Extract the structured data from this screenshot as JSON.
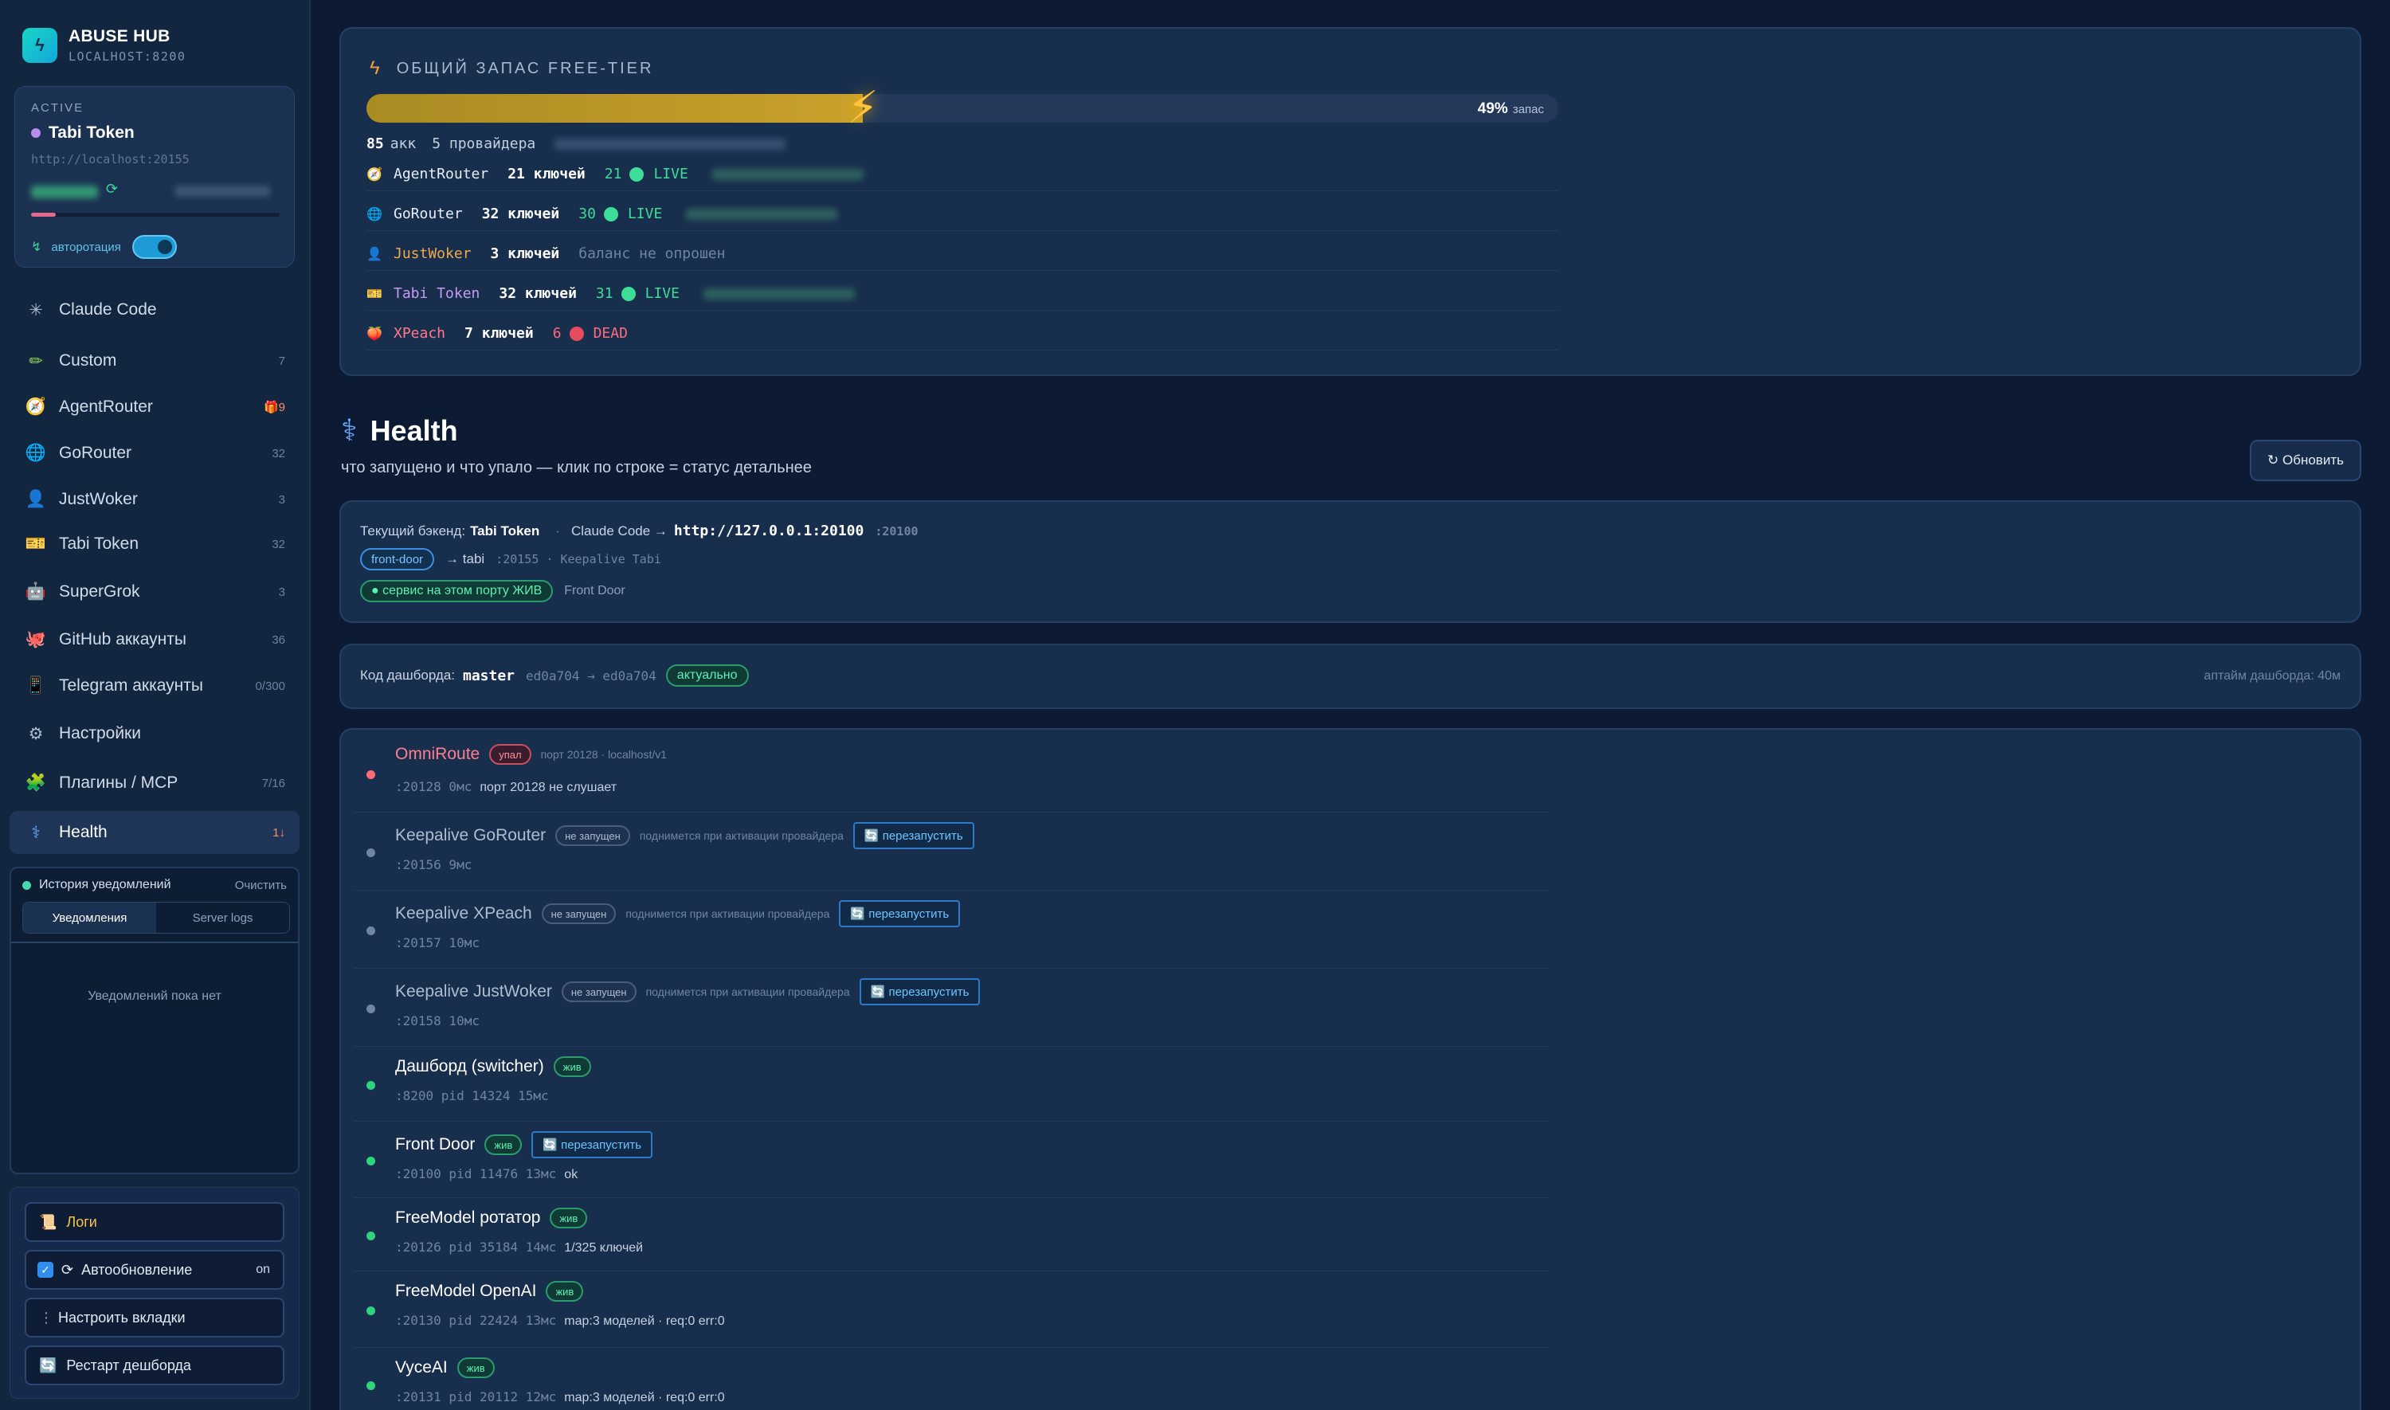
{
  "brand": {
    "title": "ABUSE HUB",
    "subtitle": "LOCALHOST:8200",
    "logo_icon": "bolt-icon"
  },
  "active": {
    "label": "ACTIVE",
    "name": "Tabi Token",
    "url": "http://localhost:20155",
    "autorotate_label": "авторотация",
    "autorotate_on": true
  },
  "nav": [
    {
      "label": "Claude Code",
      "count": "",
      "icon": "✳",
      "icon_color": "#aab8cc",
      "active": false
    },
    {
      "label": "Custom",
      "count": "7",
      "icon": "✏",
      "icon_color": "#8fd45a",
      "active": false
    },
    {
      "label": "AgentRouter",
      "count": "🎁9",
      "icon": "🧭",
      "icon_color": "#f0a050",
      "active": false
    },
    {
      "label": "GoRouter",
      "count": "32",
      "icon": "🌐",
      "icon_color": "#5aa9f0",
      "active": false
    },
    {
      "label": "JustWoker",
      "count": "3",
      "icon": "👤",
      "icon_color": "#f0b040",
      "active": false
    },
    {
      "label": "Tabi Token",
      "count": "32",
      "icon": "🎫",
      "icon_color": "#f0c040",
      "active": false
    },
    {
      "label": "SuperGrok",
      "count": "3",
      "icon": "🤖",
      "icon_color": "#e07aa0",
      "active": false
    },
    {
      "label": "GitHub аккаунты",
      "count": "36",
      "icon": "🐙",
      "icon_color": "#f07a60",
      "active": false
    },
    {
      "label": "Telegram аккаунты",
      "count": "0/300",
      "icon": "📱",
      "icon_color": "#c06a6a",
      "active": false
    },
    {
      "label": "Настройки",
      "count": "",
      "icon": "⚙",
      "icon_color": "#aab8cc",
      "active": false
    },
    {
      "label": "Плагины / MCP",
      "count": "7/16",
      "icon": "🧩",
      "icon_color": "#5ad08a",
      "active": false
    },
    {
      "label": "Health",
      "count": "1↓",
      "icon": "⚕",
      "icon_color": "#6ea9ff",
      "active": true
    }
  ],
  "notifications": {
    "title": "История уведомлений",
    "clear": "Очистить",
    "tabs": [
      "Уведомления",
      "Server logs"
    ],
    "empty": "Уведомлений пока нет"
  },
  "bottom": {
    "logs": "Логи",
    "autoupdate": "Автообновление",
    "autoupdate_state": "on",
    "customize_tabs": "Настроить вкладки",
    "restart": "Рестарт дешборда"
  },
  "freetier": {
    "title": "ОБЩИЙ ЗАПАС FREE-TIER",
    "percent": 49,
    "percent_label": "49%",
    "suffix": "запас",
    "accounts": "85",
    "accounts_unit": "акк",
    "providers": "5 провайдера",
    "rows": [
      {
        "name": "AgentRouter",
        "name_color": "#e8eef7",
        "icon": "🧭",
        "keys": "21 ключей",
        "num": "21",
        "status": "LIVE",
        "status_color": "#3ddc97",
        "dot_color": "#3ddc97"
      },
      {
        "name": "GoRouter",
        "name_color": "#e8eef7",
        "icon": "🌐",
        "keys": "32 ключей",
        "num": "30",
        "status": "LIVE",
        "status_color": "#3ddc97",
        "dot_color": "#3ddc97"
      },
      {
        "name": "JustWoker",
        "name_color": "#f0a94a",
        "icon": "👤",
        "keys": "3 ключей",
        "num": "",
        "status": "баланс не опрошен",
        "status_color": "#6f85a3",
        "dot_color": ""
      },
      {
        "name": "Tabi Token",
        "name_color": "#c79af0",
        "icon": "🎫",
        "keys": "32 ключей",
        "num": "31",
        "status": "LIVE",
        "status_color": "#3ddc97",
        "dot_color": "#3ddc97"
      },
      {
        "name": "XPeach",
        "name_color": "#ff7a8a",
        "icon": "🍑",
        "keys": "7 ключей",
        "num": "6",
        "status": "DEAD",
        "status_color": "#ff6b7d",
        "dot_color": "#e84a5f"
      }
    ]
  },
  "health": {
    "title": "Health",
    "subtitle": "что запущено и что упало — клик по строке = статус детальнее",
    "refresh": "↻ Обновить"
  },
  "backend": {
    "label": "Текущий бэкенд:",
    "name": "Tabi Token",
    "sep": "·",
    "cc_label": "Claude Code →",
    "cc_url": "http://127.0.0.1:20100",
    "cc_port": ":20100",
    "tag": "front-door",
    "arrow": "→ tabi",
    "arrow_port": ":20155 · Keepalive Tabi",
    "alive": "● сервис на этом порту ЖИВ",
    "alive_note": "Front Door"
  },
  "code": {
    "label": "Код дашборда:",
    "branch": "master",
    "commit": "ed0a704 → ed0a704",
    "status": "актуально",
    "uptime": "аптайм дашборда: 40м"
  },
  "services": [
    {
      "name": "OmniRoute",
      "state": "dead",
      "badge": "упал",
      "note": "порт 20128 · localhost/v1",
      "restart": "",
      "meta": ":20128  0мс",
      "extra": "порт 20128 не слушает"
    },
    {
      "name": "Keepalive GoRouter",
      "state": "off",
      "badge": "не запущен",
      "note": "поднимется при активации провайдера",
      "restart": "🔄 перезапустить",
      "meta": ":20156  9мс",
      "extra": ""
    },
    {
      "name": "Keepalive XPeach",
      "state": "off",
      "badge": "не запущен",
      "note": "поднимется при активации провайдера",
      "restart": "🔄 перезапустить",
      "meta": ":20157  10мс",
      "extra": ""
    },
    {
      "name": "Keepalive JustWoker",
      "state": "off",
      "badge": "не запущен",
      "note": "поднимется при активации провайдера",
      "restart": "🔄 перезапустить",
      "meta": ":20158  10мс",
      "extra": ""
    },
    {
      "name": "Дашборд (switcher)",
      "state": "live",
      "badge": "жив",
      "note": "",
      "restart": "",
      "meta": ":8200  pid 14324  15мс",
      "extra": ""
    },
    {
      "name": "Front Door",
      "state": "live",
      "badge": "жив",
      "note": "",
      "restart": "🔄 перезапустить",
      "meta": ":20100  pid 11476  13мс",
      "extra": "ok"
    },
    {
      "name": "FreeModel ротатор",
      "state": "live",
      "badge": "жив",
      "note": "",
      "restart": "",
      "meta": ":20126  pid 35184  14мс",
      "extra": "1/325 ключей"
    },
    {
      "name": "FreeModel OpenAI",
      "state": "live",
      "badge": "жив",
      "note": "",
      "restart": "",
      "meta": ":20130  pid 22424  13мс",
      "extra": "map:3 моделей · req:0 err:0"
    },
    {
      "name": "VyceAI",
      "state": "live",
      "badge": "жив",
      "note": "",
      "restart": "",
      "meta": ":20131  pid 20112  12мс",
      "extra": "map:3 моделей · req:0 err:0"
    }
  ]
}
